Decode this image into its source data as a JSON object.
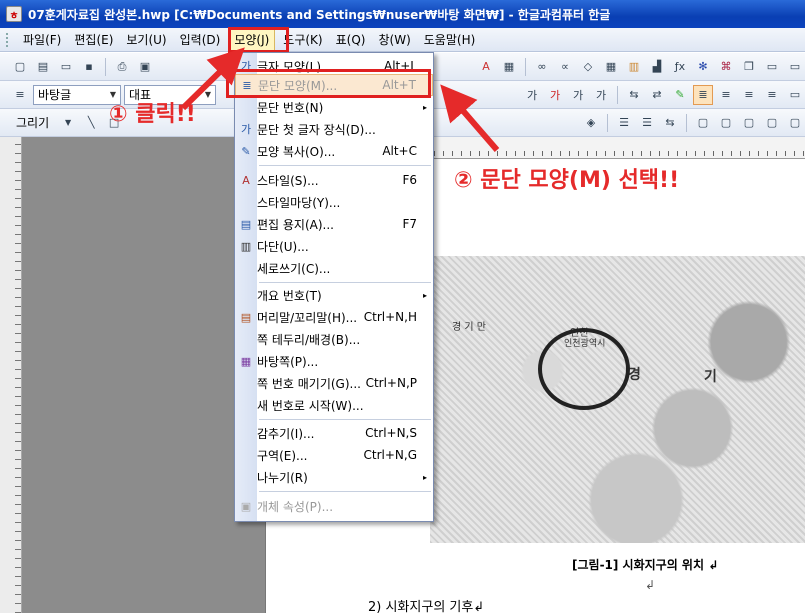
{
  "window": {
    "title": "07훈게자료집 완성본.hwp [C:₩Documents and Settings₩nuser₩바탕 화면₩] - 한글과컴퓨터 한글"
  },
  "menubar": {
    "items": [
      "파일(F)",
      "편집(E)",
      "보기(U)",
      "입력(D)",
      "모양(J)",
      "도구(K)",
      "표(Q)",
      "창(W)",
      "도움말(H)"
    ]
  },
  "toolbar": {
    "style_combo": "바탕글",
    "font_combo": "대표",
    "draw_label": "그리기"
  },
  "dropdown": {
    "items": [
      {
        "label": "글자 모양(L)...",
        "shortcut": "Alt+L",
        "icon": "char-shape-icon"
      },
      {
        "label": "문단 모양(M)...",
        "shortcut": "Alt+T",
        "icon": "para-shape-icon"
      },
      {
        "label": "문단 번호(N)",
        "shortcut": "",
        "icon": ""
      },
      {
        "label": "문단 첫 글자 장식(D)...",
        "shortcut": "",
        "icon": "dropcap-icon"
      },
      {
        "label": "모양 복사(O)...",
        "shortcut": "Alt+C",
        "icon": "format-paint-icon"
      },
      {
        "label": "스타일(S)...",
        "shortcut": "F6",
        "icon": "style-icon"
      },
      {
        "label": "스타일마당(Y)...",
        "shortcut": "",
        "icon": ""
      },
      {
        "label": "편집 용지(A)...",
        "shortcut": "F7",
        "icon": "page-setup-icon"
      },
      {
        "label": "다단(U)...",
        "shortcut": "",
        "icon": "columns-icon"
      },
      {
        "label": "세로쓰기(C)...",
        "shortcut": "",
        "icon": ""
      },
      {
        "label": "개요 번호(T)",
        "shortcut": "",
        "icon": ""
      },
      {
        "label": "머리말/꼬리말(H)...",
        "shortcut": "Ctrl+N,H",
        "icon": "header-footer-icon"
      },
      {
        "label": "쪽 테두리/배경(B)...",
        "shortcut": "",
        "icon": ""
      },
      {
        "label": "바탕쪽(P)...",
        "shortcut": "",
        "icon": "master-page-icon"
      },
      {
        "label": "쪽 번호 매기기(G)...",
        "shortcut": "Ctrl+N,P",
        "icon": ""
      },
      {
        "label": "새 번호로 시작(W)...",
        "shortcut": "",
        "icon": ""
      },
      {
        "label": "감추기(I)...",
        "shortcut": "Ctrl+N,S",
        "icon": ""
      },
      {
        "label": "구역(E)...",
        "shortcut": "Ctrl+N,G",
        "icon": ""
      },
      {
        "label": "나누기(R)",
        "shortcut": "",
        "icon": ""
      },
      {
        "label": "개체 속성(P)...",
        "shortcut": "",
        "icon": "object-props-icon"
      }
    ]
  },
  "annotations": {
    "step1": "① 클릭!!",
    "step2": "② 문단 모양(M) 선택!!"
  },
  "document": {
    "map_labels": [
      "경 기 만",
      "인천",
      "인천광역시",
      "경",
      "기"
    ],
    "caption": "[그림-1] 시화지구의 위치 ↲",
    "caption_mark": "↲",
    "body_line": "2) 시화지구의 기후↲"
  }
}
